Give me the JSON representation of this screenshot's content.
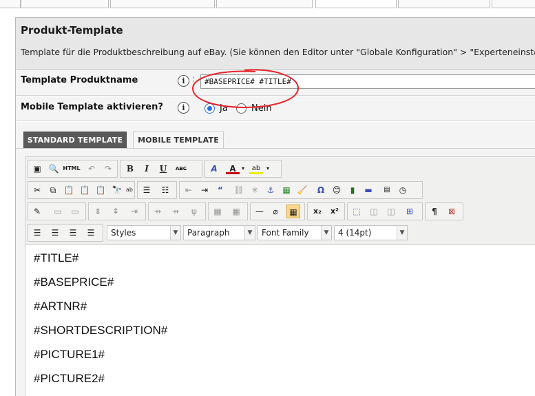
{
  "section": {
    "title": "Produkt-Template",
    "description": "Template für die Produktbeschreibung auf eBay. (Sie können den Editor unter \"Globale Konfiguration\" > \"Experteneinste"
  },
  "fields": {
    "template_name": {
      "label": "Template Produktname",
      "value": "#BASEPRICE# #TITLE#"
    },
    "mobile": {
      "label": "Mobile Template aktivieren?",
      "options": [
        {
          "label": "Ja",
          "selected": true
        },
        {
          "label": "Nein",
          "selected": false
        }
      ]
    }
  },
  "editor": {
    "tabs": [
      {
        "label": "STANDARD TEMPLATE",
        "active": true
      },
      {
        "label": "MOBILE TEMPLATE",
        "active": false
      }
    ],
    "dropdowns": {
      "styles": "Styles",
      "format": "Paragraph",
      "font_family": "Font Family",
      "font_size": "4 (14pt)"
    },
    "toolbar_icons": {
      "html_label": "HTML",
      "special_char": "Ω",
      "paragraph": "¶",
      "bold": "B",
      "italic": "I",
      "underline": "U",
      "strike": "ABC"
    },
    "lines": [
      "#TITLE#",
      "#BASEPRICE#",
      "#ARTNR#",
      "#SHORTDESCRIPTION#",
      "#PICTURE1#",
      "#PICTURE2#"
    ]
  },
  "colors": {
    "active_tab": "#595959",
    "annotation_red": "#e8242b",
    "radio_selected": "#2a6fd6"
  }
}
